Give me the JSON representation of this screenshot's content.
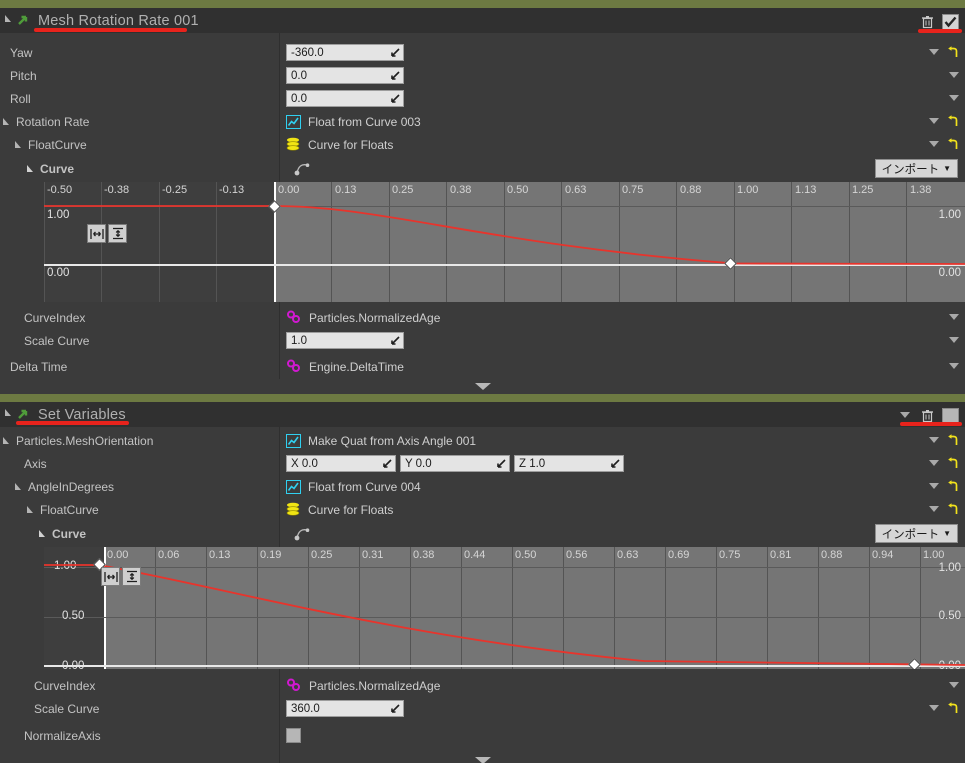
{
  "sections": [
    {
      "id": "mesh-rotation-rate",
      "title": "Mesh Rotation Rate 001",
      "header_icons": {
        "delete": "trash-icon",
        "enabled": "checkbox-checked"
      },
      "rows": [
        {
          "label": "Yaw",
          "indent": 0,
          "tri": "none",
          "type": "number",
          "value": "-360.0",
          "reset": true,
          "caret": true
        },
        {
          "label": "Pitch",
          "indent": 0,
          "tri": "none",
          "type": "number",
          "value": "0.0",
          "reset": false,
          "caret": true
        },
        {
          "label": "Roll",
          "indent": 0,
          "tri": "none",
          "type": "number",
          "value": "0.0",
          "reset": false,
          "caret": true
        },
        {
          "label": "Rotation Rate",
          "indent": 0,
          "tri": "open",
          "type": "graph",
          "value": "Float from Curve 003",
          "reset": true,
          "caret": true
        },
        {
          "label": "FloatCurve",
          "indent": 1,
          "tri": "open",
          "type": "stack",
          "value": "Curve for Floats",
          "reset": true,
          "caret": true
        },
        {
          "label": "Curve",
          "indent": 2,
          "tri": "open",
          "type": "curve",
          "value": "",
          "bold": true
        }
      ],
      "curve": {
        "import_label": "インポート",
        "xticks": [
          "-0.50",
          "-0.38",
          "-0.25",
          "-0.13",
          "0.00",
          "0.13",
          "0.25",
          "0.38",
          "0.50",
          "0.63",
          "0.75",
          "0.88",
          "1.00",
          "1.13",
          "1.25",
          "1.38"
        ],
        "ylabels_left": [
          "1.00",
          "0.00"
        ],
        "ylabels_right": [
          "1.00",
          "0.00"
        ],
        "keys": [
          {
            "x": 0.0,
            "y": 1.0
          },
          {
            "x": 1.0,
            "y": 0.0
          }
        ]
      },
      "rows_after": [
        {
          "label": "CurveIndex",
          "indent": 1,
          "tri": "none",
          "type": "link",
          "value": "Particles.NormalizedAge",
          "caret": true
        },
        {
          "label": "Scale Curve",
          "indent": 1,
          "tri": "none",
          "type": "number",
          "value": "1.0",
          "caret": true
        },
        {
          "label": "Delta Time",
          "indent": 0,
          "tri": "none",
          "type": "link",
          "value": "Engine.DeltaTime",
          "caret": true
        }
      ]
    },
    {
      "id": "set-variables",
      "title": "Set Variables",
      "header_icons": {
        "delete": "trash-icon",
        "enabled": "checkbox-unchecked",
        "caret": "chevron-down-icon"
      },
      "rows": [
        {
          "label": "Particles.MeshOrientation",
          "indent": 0,
          "tri": "open",
          "type": "graph",
          "value": "Make Quat from Axis Angle 001",
          "reset": true,
          "caret": false
        },
        {
          "label": "Axis",
          "indent": 1,
          "tri": "none",
          "type": "vector",
          "value": [
            "X 0.0",
            "Y 0.0",
            "Z 1.0"
          ],
          "reset": true,
          "caret": true
        },
        {
          "label": "AngleInDegrees",
          "indent": 1,
          "tri": "open",
          "type": "graph",
          "value": "Float from Curve 004",
          "reset": true,
          "caret": true
        },
        {
          "label": "FloatCurve",
          "indent": 2,
          "tri": "open",
          "type": "stack",
          "value": "Curve for Floats",
          "reset": true,
          "caret": true
        },
        {
          "label": "Curve",
          "indent": 3,
          "tri": "open",
          "type": "curve",
          "value": "",
          "bold": true
        }
      ],
      "curve": {
        "import_label": "インポート",
        "xticks": [
          "0.00",
          "0.06",
          "0.13",
          "0.19",
          "0.25",
          "0.31",
          "0.38",
          "0.44",
          "0.50",
          "0.56",
          "0.63",
          "0.69",
          "0.75",
          "0.81",
          "0.88",
          "0.94",
          "1.00"
        ],
        "ylabels_left": [
          "1.00",
          "0.50",
          "0.00"
        ],
        "ylabels_right": [
          "1.00",
          "0.50",
          "0.00"
        ],
        "keys": [
          {
            "x": 0.0,
            "y": 1.0
          },
          {
            "x": 1.0,
            "y": 0.0
          }
        ]
      },
      "rows_after": [
        {
          "label": "CurveIndex",
          "indent": 1,
          "tri": "none",
          "type": "link",
          "value": "Particles.NormalizedAge",
          "caret": true
        },
        {
          "label": "Scale Curve",
          "indent": 1,
          "tri": "none",
          "type": "number",
          "value": "360.0",
          "reset": true,
          "caret": true
        },
        {
          "label": "NormalizeAxis",
          "indent": 1,
          "tri": "none",
          "type": "checkbox",
          "value": "",
          "caret": false
        }
      ]
    }
  ],
  "colors": {
    "accent_green": "#6d7a42",
    "curve_red": "#e8342c",
    "link_magenta": "#d119d1",
    "graph_cyan": "#30d0f0",
    "stack_yellow": "#f0e414",
    "reset_yellow": "#f2e21c",
    "annotation_red": "#e8231c"
  }
}
